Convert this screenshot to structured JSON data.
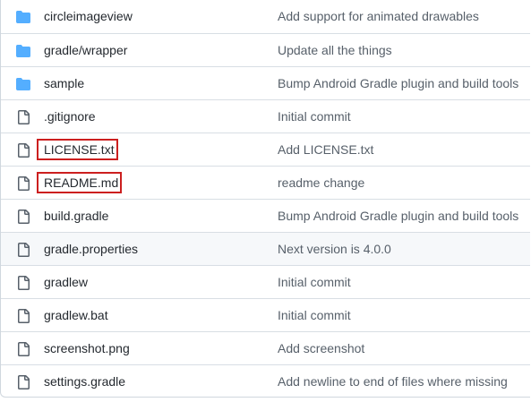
{
  "colors": {
    "folder": "#54aeff",
    "file": "#57606a",
    "highlight_border": "#cc1f1f",
    "hover_row": "#f6f8fa"
  },
  "files": [
    {
      "name": "circleimageview",
      "type": "folder",
      "icon": "folder-icon",
      "commit": "Add support for animated drawables"
    },
    {
      "name": "gradle/wrapper",
      "type": "folder",
      "icon": "folder-icon",
      "commit": "Update all the things"
    },
    {
      "name": "sample",
      "type": "folder",
      "icon": "folder-icon",
      "commit": "Bump Android Gradle plugin and build tools"
    },
    {
      "name": ".gitignore",
      "type": "file",
      "icon": "file-icon",
      "commit": "Initial commit"
    },
    {
      "name": "LICENSE.txt",
      "type": "file",
      "icon": "file-icon",
      "commit": "Add LICENSE.txt",
      "highlighted": true
    },
    {
      "name": "README.md",
      "type": "file",
      "icon": "file-icon",
      "commit": "readme change",
      "highlighted": true
    },
    {
      "name": "build.gradle",
      "type": "file",
      "icon": "file-icon",
      "commit": "Bump Android Gradle plugin and build tools"
    },
    {
      "name": "gradle.properties",
      "type": "file",
      "icon": "file-icon",
      "commit": "Next version is 4.0.0",
      "hovered": true
    },
    {
      "name": "gradlew",
      "type": "file",
      "icon": "file-icon",
      "commit": "Initial commit"
    },
    {
      "name": "gradlew.bat",
      "type": "file",
      "icon": "file-icon",
      "commit": "Initial commit"
    },
    {
      "name": "screenshot.png",
      "type": "file",
      "icon": "file-icon",
      "commit": "Add screenshot"
    },
    {
      "name": "settings.gradle",
      "type": "file",
      "icon": "file-icon",
      "commit": "Add newline to end of files where missing"
    }
  ]
}
